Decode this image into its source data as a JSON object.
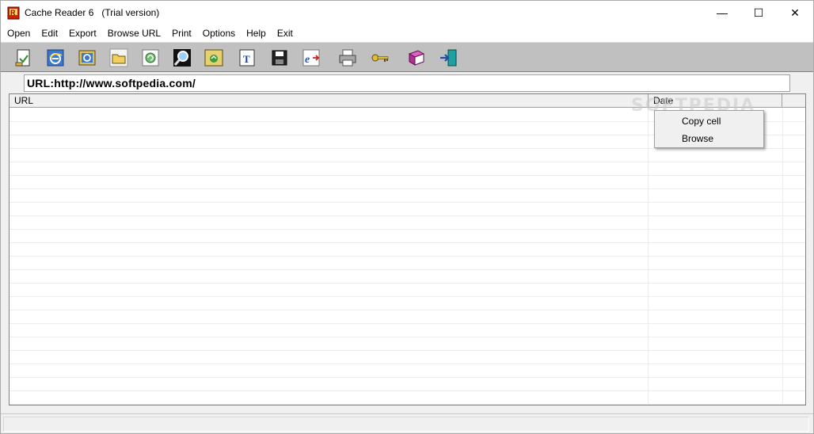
{
  "window": {
    "title": "Cache Reader 6   (Trial version)",
    "min_glyph": "—",
    "max_glyph": "☐",
    "close_glyph": "✕"
  },
  "menu": {
    "items": [
      "Open",
      "Edit",
      "Export",
      "Browse URL",
      "Print",
      "Options",
      "Help",
      "Exit"
    ]
  },
  "toolbar": {
    "buttons": [
      "open-file-icon",
      "internet-explorer-icon",
      "ie-cache-icon",
      "folder-icon",
      "refresh-cache-icon",
      "search-icon",
      "sync-folder-icon",
      "text-icon",
      "save-icon",
      "ie-export-icon",
      "print-icon",
      "key-icon",
      "help-book-icon",
      "exit-icon"
    ]
  },
  "url_field": {
    "value": "URL:http://www.softpedia.com/"
  },
  "grid": {
    "columns": [
      "URL",
      "Date"
    ]
  },
  "watermark": "SOFTPEDIA",
  "context_menu": {
    "items": [
      "Copy cell",
      "Browse"
    ]
  }
}
